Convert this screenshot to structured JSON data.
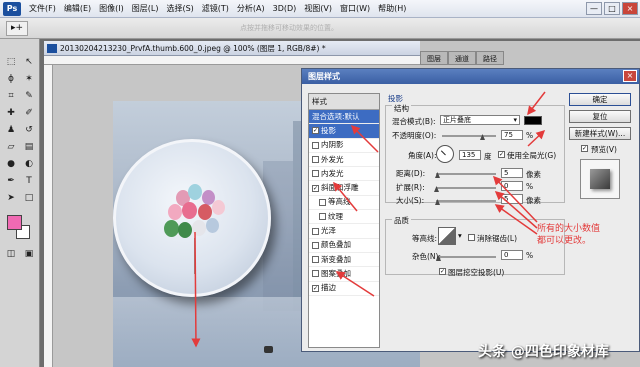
{
  "menubar": {
    "logo": "Ps",
    "items": [
      "文件(F)",
      "编辑(E)",
      "图像(I)",
      "图层(L)",
      "选择(S)",
      "滤镜(T)",
      "分析(A)",
      "3D(D)",
      "视图(V)",
      "窗口(W)",
      "帮助(H)"
    ]
  },
  "window_buttons": {
    "minimize": "—",
    "maximize": "□",
    "close": "×"
  },
  "options_bar": {
    "tool_glyph": "▸+",
    "hint": "点按并拖移可移动效果的位置。"
  },
  "document": {
    "tab_title": "20130204213230_PrvfA.thumb.600_0.jpeg @ 100% (图层 1, RGB/8#) *"
  },
  "panel_tabs": [
    "图层",
    "通道",
    "路径"
  ],
  "dialog": {
    "title": "图层样式",
    "close": "×",
    "styles_header": "样式",
    "blend_options": "混合选项:默认",
    "styles": [
      {
        "label": "投影",
        "checked": true,
        "selected": true,
        "indent": false
      },
      {
        "label": "内阴影",
        "checked": false,
        "selected": false,
        "indent": false
      },
      {
        "label": "外发光",
        "checked": false,
        "selected": false,
        "indent": false
      },
      {
        "label": "内发光",
        "checked": false,
        "selected": false,
        "indent": false
      },
      {
        "label": "斜面和浮雕",
        "checked": true,
        "selected": false,
        "indent": false
      },
      {
        "label": "等高线",
        "checked": false,
        "selected": false,
        "indent": true
      },
      {
        "label": "纹理",
        "checked": false,
        "selected": false,
        "indent": true
      },
      {
        "label": "光泽",
        "checked": false,
        "selected": false,
        "indent": false
      },
      {
        "label": "颜色叠加",
        "checked": false,
        "selected": false,
        "indent": false
      },
      {
        "label": "渐变叠加",
        "checked": false,
        "selected": false,
        "indent": false
      },
      {
        "label": "图案叠加",
        "checked": false,
        "selected": false,
        "indent": false
      },
      {
        "label": "描边",
        "checked": true,
        "selected": false,
        "indent": false
      }
    ],
    "section_title": "投影",
    "structure": {
      "title": "结构",
      "blend_mode_label": "混合模式(B):",
      "blend_mode_value": "正片叠底",
      "opacity_label": "不透明度(O):",
      "opacity_value": "75",
      "opacity_unit": "%",
      "opacity_fraction": 0.75,
      "angle_label": "角度(A):",
      "angle_value": "135",
      "angle_unit": "度",
      "global_light_label": "使用全局光(G)",
      "distance_label": "距离(D):",
      "distance_value": "5",
      "distance_unit": "像素",
      "spread_label": "扩展(R):",
      "spread_value": "0",
      "spread_unit": "%",
      "size_label": "大小(S):",
      "size_value": "5",
      "size_unit": "像素"
    },
    "quality": {
      "title": "品质",
      "contour_label": "等高线:",
      "anti_alias_label": "消除锯齿(L)",
      "noise_label": "杂色(N):",
      "noise_value": "0",
      "noise_unit": "%",
      "knockout_label": "图层挖空投影(U)"
    },
    "buttons": {
      "ok": "确定",
      "reset": "复位",
      "new_style": "新建样式(W)...",
      "preview": "预览(V)"
    },
    "shadow_color": "#000000"
  },
  "annotation": {
    "line1": "所有的大小数值",
    "line2": "都可以更改。"
  },
  "watermark": "头条 @四色印象材库"
}
